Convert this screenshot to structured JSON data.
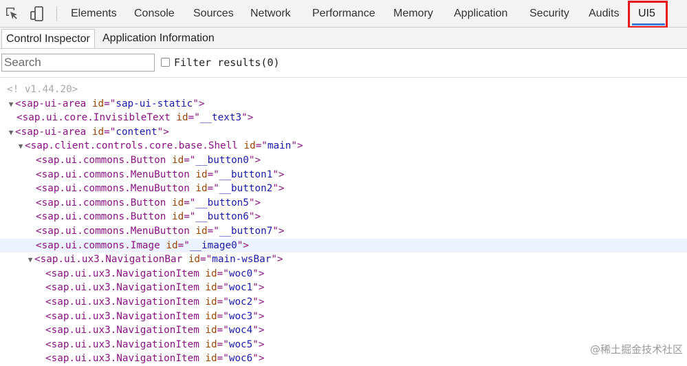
{
  "toolbar": {
    "icons": [
      "inspect-element-icon",
      "device-toggle-icon"
    ]
  },
  "tabs": [
    {
      "label": "Elements"
    },
    {
      "label": "Console"
    },
    {
      "label": "Sources"
    },
    {
      "label": "Network"
    },
    {
      "label": "Performance"
    },
    {
      "label": "Memory"
    },
    {
      "label": "Application"
    },
    {
      "label": "Security"
    },
    {
      "label": "Audits"
    },
    {
      "label": "UI5"
    }
  ],
  "active_tab": "UI5",
  "subtabs": [
    {
      "label": "Control Inspector"
    },
    {
      "label": "Application Information"
    }
  ],
  "search": {
    "placeholder": "Search",
    "value": "",
    "filter_label": "Filter results(0)",
    "filter_checked": false
  },
  "tree": {
    "version_comment": "<! v1.44.20>",
    "rows": [
      {
        "expanded": true,
        "tag": "sap-ui-area",
        "id": "sap-ui-static"
      },
      {
        "expanded": null,
        "tag": "sap.ui.core.InvisibleText",
        "id": "__text3"
      },
      {
        "expanded": true,
        "tag": "sap-ui-area",
        "id": "content"
      },
      {
        "expanded": true,
        "tag": "sap.client.controls.core.base.Shell",
        "id": "main"
      },
      {
        "expanded": null,
        "tag": "sap.ui.commons.Button",
        "id": "__button0"
      },
      {
        "expanded": null,
        "tag": "sap.ui.commons.MenuButton",
        "id": "__button1"
      },
      {
        "expanded": null,
        "tag": "sap.ui.commons.MenuButton",
        "id": "__button2"
      },
      {
        "expanded": null,
        "tag": "sap.ui.commons.Button",
        "id": "__button5"
      },
      {
        "expanded": null,
        "tag": "sap.ui.commons.Button",
        "id": "__button6"
      },
      {
        "expanded": null,
        "tag": "sap.ui.commons.MenuButton",
        "id": "__button7"
      },
      {
        "expanded": null,
        "tag": "sap.ui.commons.Image",
        "id": "__image0",
        "selected": true
      },
      {
        "expanded": true,
        "tag": "sap.ui.ux3.NavigationBar",
        "id": "main-wsBar"
      },
      {
        "expanded": null,
        "tag": "sap.ui.ux3.NavigationItem",
        "id": "woc0"
      },
      {
        "expanded": null,
        "tag": "sap.ui.ux3.NavigationItem",
        "id": "woc1"
      },
      {
        "expanded": null,
        "tag": "sap.ui.ux3.NavigationItem",
        "id": "woc2"
      },
      {
        "expanded": null,
        "tag": "sap.ui.ux3.NavigationItem",
        "id": "woc3"
      },
      {
        "expanded": null,
        "tag": "sap.ui.ux3.NavigationItem",
        "id": "woc4"
      },
      {
        "expanded": null,
        "tag": "sap.ui.ux3.NavigationItem",
        "id": "woc5"
      },
      {
        "expanded": null,
        "tag": "sap.ui.ux3.NavigationItem",
        "id": "woc6"
      }
    ]
  },
  "watermark": "@稀土掘金技术社区",
  "colors": {
    "tag": "#881280",
    "attr": "#994500",
    "value": "#1a1aa6",
    "highlight_box": "#e8171b",
    "active_underline": "#3879d9",
    "selected_row": "#edf3fe"
  }
}
